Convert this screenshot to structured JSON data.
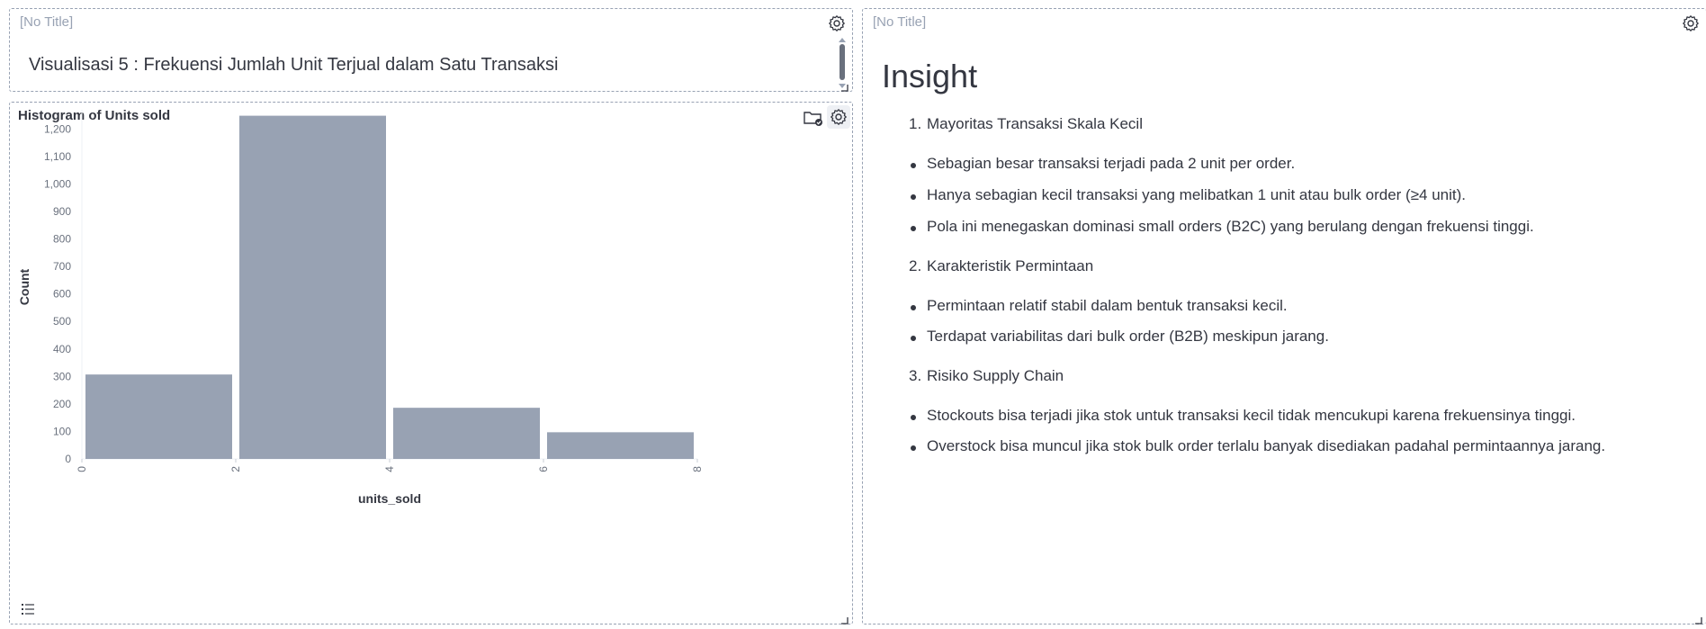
{
  "title_panel": {
    "header": "[No Title]",
    "text": "Visualisasi 5 : Frekuensi Jumlah Unit Terjual dalam Satu Transaksi",
    "gear_icon": "gear-icon"
  },
  "histogram_panel": {
    "title": "Histogram of Units sold",
    "gear_icon": "gear-icon",
    "folder_icon": "folder-check-icon",
    "legend_icon": "list-icon"
  },
  "insight_panel": {
    "header": "[No Title]",
    "heading": "Insight",
    "items": [
      {
        "kind": "num",
        "n": "1.",
        "text": "Mayoritas Transaksi Skala Kecil"
      },
      {
        "kind": "bullet",
        "text": "Sebagian besar transaksi terjadi pada 2 unit per order."
      },
      {
        "kind": "bullet",
        "text": "Hanya sebagian kecil transaksi yang melibatkan 1 unit atau bulk order (≥4 unit)."
      },
      {
        "kind": "bullet",
        "text": "Pola ini menegaskan dominasi small orders (B2C) yang berulang dengan frekuensi tinggi."
      },
      {
        "kind": "num",
        "n": "2.",
        "text": "Karakteristik Permintaan"
      },
      {
        "kind": "bullet",
        "text": "Permintaan relatif stabil dalam bentuk transaksi kecil."
      },
      {
        "kind": "bullet",
        "text": "Terdapat variabilitas dari bulk order (B2B) meskipun jarang."
      },
      {
        "kind": "num",
        "n": "3.",
        "text": "Risiko Supply Chain"
      },
      {
        "kind": "bullet",
        "text": "Stockouts bisa terjadi jika stok untuk transaksi kecil tidak mencukupi karena frekuensinya tinggi."
      },
      {
        "kind": "bullet",
        "text": "Overstock bisa muncul jika stok bulk order terlalu banyak disediakan padahal permintaannya jarang."
      }
    ]
  },
  "colors": {
    "bar": "#98a2b3",
    "axis_text": "#69707d",
    "border": "#98a2b3"
  },
  "chart_data": {
    "type": "bar",
    "xlabel": "units_sold",
    "ylabel": "Count",
    "x_ticks": [
      "0",
      "2",
      "4",
      "6",
      "8"
    ],
    "y_ticks": [
      "0",
      "100",
      "200",
      "300",
      "400",
      "500",
      "600",
      "700",
      "800",
      "900",
      "1,000",
      "1,100",
      "1,200"
    ],
    "ylim": [
      0,
      1250
    ],
    "xlim": [
      0,
      8
    ],
    "bins": [
      {
        "start": 0,
        "end": 2,
        "value": 307
      },
      {
        "start": 2,
        "end": 4,
        "value": 1248
      },
      {
        "start": 4,
        "end": 6,
        "value": 186
      },
      {
        "start": 6,
        "end": 8,
        "value": 97
      }
    ],
    "grid": false,
    "legend": "none"
  }
}
